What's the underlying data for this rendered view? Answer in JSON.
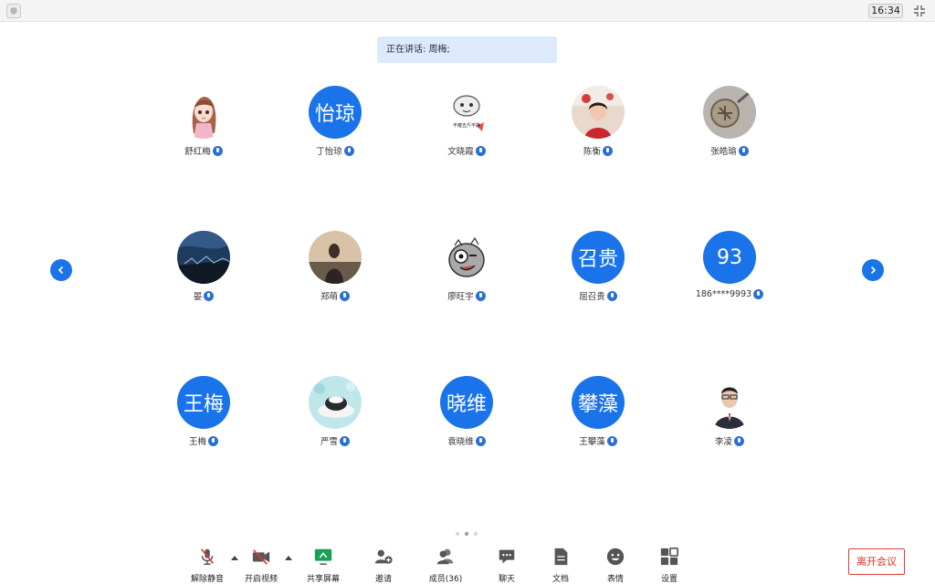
{
  "topbar": {
    "clock": "16:34"
  },
  "banner": {
    "speaking": "正在讲话: 周梅;"
  },
  "participants": [
    {
      "name": "舒红梅",
      "avatar_text": ""
    },
    {
      "name": "丁怡琼",
      "avatar_text": "怡琼"
    },
    {
      "name": "文晓霞",
      "avatar_text": "",
      "sticker_text": "不瘦五斤不换"
    },
    {
      "name": "陈衡",
      "avatar_text": ""
    },
    {
      "name": "张皓瑜",
      "avatar_text": ""
    },
    {
      "name": "晏",
      "avatar_text": ""
    },
    {
      "name": "郑萌",
      "avatar_text": ""
    },
    {
      "name": "廖旺宇",
      "avatar_text": ""
    },
    {
      "name": "屈召贵",
      "avatar_text": "召贵"
    },
    {
      "name": "186****9993",
      "avatar_text": "93"
    },
    {
      "name": "王梅",
      "avatar_text": "王梅"
    },
    {
      "name": "严雪",
      "avatar_text": ""
    },
    {
      "name": "袁晓维",
      "avatar_text": "晓维"
    },
    {
      "name": "王攀藻",
      "avatar_text": "攀藻"
    },
    {
      "name": "李凌",
      "avatar_text": ""
    }
  ],
  "toolbar": {
    "unmute": "解除静音",
    "video": "开启视频",
    "share": "共享屏幕",
    "invite": "邀请",
    "members": "成员(36)",
    "chat": "聊天",
    "docs": "文档",
    "emoji": "表情",
    "settings": "设置",
    "leave": "离开会议"
  },
  "colors": {
    "accent": "#1a73e8",
    "danger": "#d9302b",
    "share_green": "#18a058"
  }
}
